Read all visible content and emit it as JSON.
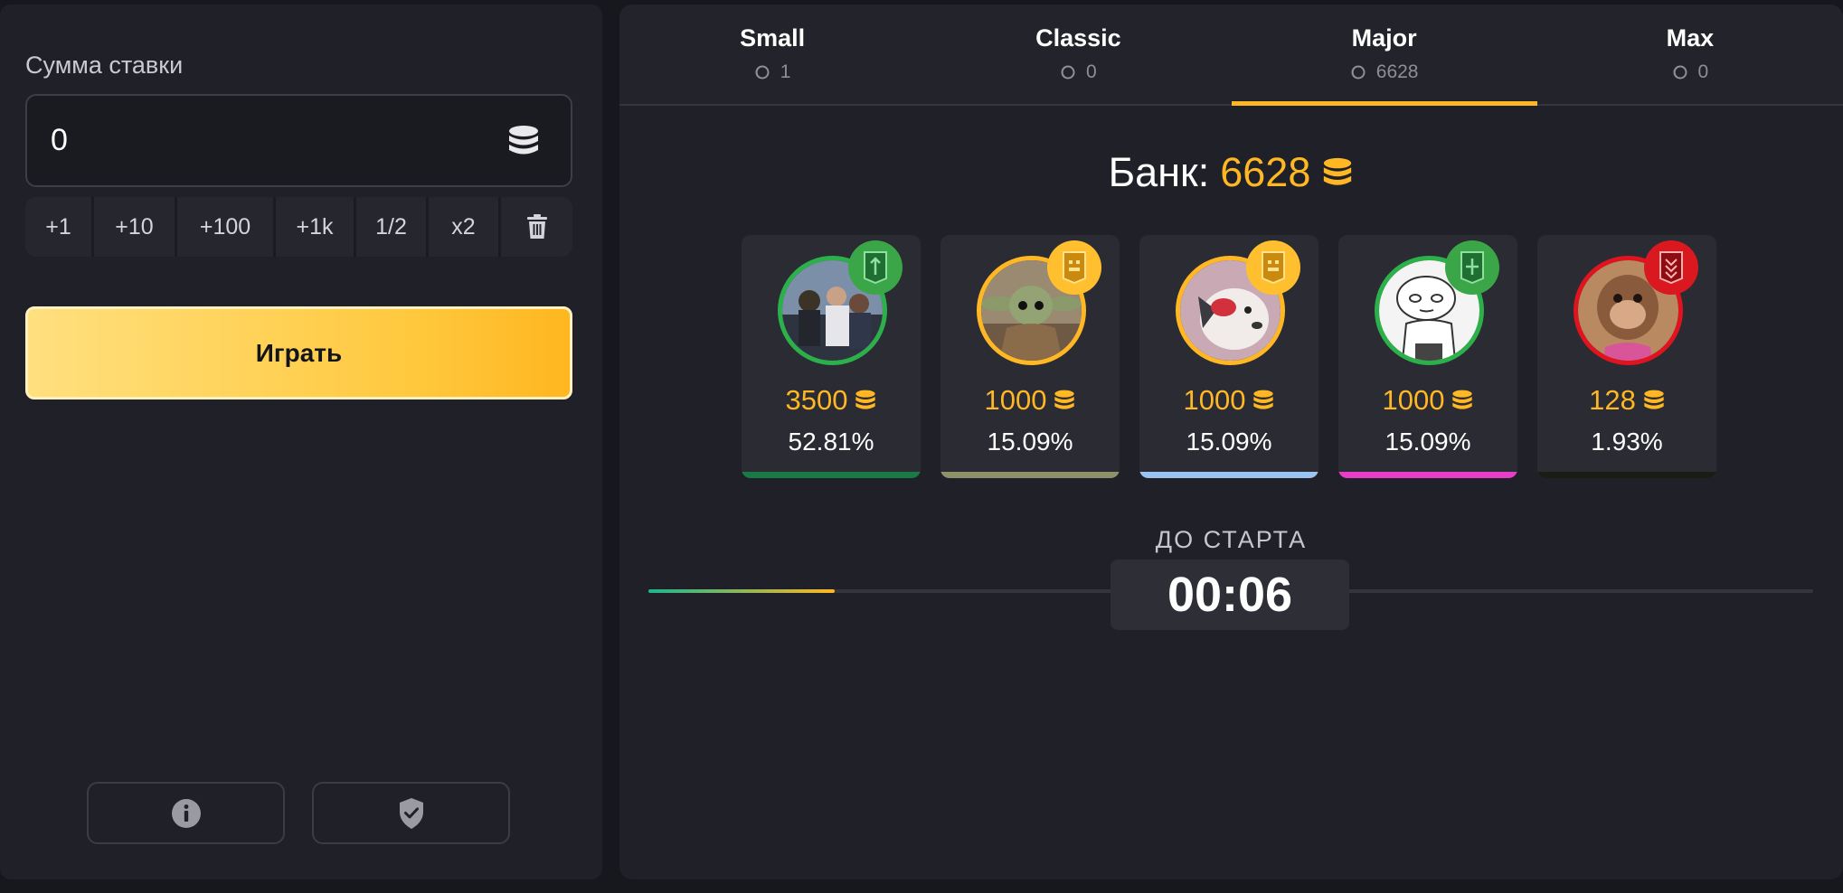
{
  "bet": {
    "label": "Сумма ставки",
    "value": "0"
  },
  "quick_buttons": [
    "+1",
    "+10",
    "+100",
    "+1k",
    "1/2",
    "x2"
  ],
  "play_label": "Играть",
  "footer_icons": [
    "info-icon",
    "shield-check-icon"
  ],
  "tabs": [
    {
      "name": "Small",
      "count": "1",
      "active": false
    },
    {
      "name": "Classic",
      "count": "0",
      "active": false
    },
    {
      "name": "Major",
      "count": "6628",
      "active": true
    },
    {
      "name": "Max",
      "count": "0",
      "active": false
    }
  ],
  "bank": {
    "label": "Банк:",
    "value": "6628"
  },
  "players": [
    {
      "amount": "3500",
      "percent": "52.81%",
      "ring_color": "#2bb04a",
      "badge_color": "#3aa648",
      "bar_color": "#1a7a43",
      "avatar": "crowd-photo"
    },
    {
      "amount": "1000",
      "percent": "15.09%",
      "ring_color": "#ffb724",
      "badge_color": "#ffbf2e",
      "bar_color": "#8f916a",
      "avatar": "baby-alien-photo"
    },
    {
      "amount": "1000",
      "percent": "15.09%",
      "ring_color": "#ffb724",
      "badge_color": "#ffbf2e",
      "bar_color": "#9bc4f2",
      "avatar": "dog-photo"
    },
    {
      "amount": "1000",
      "percent": "15.09%",
      "ring_color": "#2bb04a",
      "badge_color": "#3aa648",
      "bar_color": "#e83ec7",
      "avatar": "cartoon-baby"
    },
    {
      "amount": "128",
      "percent": "1.93%",
      "ring_color": "#e0141e",
      "badge_color": "#d91820",
      "bar_color": "#1b1d14",
      "avatar": "monkey-photo"
    }
  ],
  "countdown": {
    "label": "ДО СТАРТА",
    "time": "00:06",
    "progress": 0.16
  },
  "colors": {
    "accent": "#ffb724",
    "panel": "#202128",
    "background": "#17181d"
  }
}
